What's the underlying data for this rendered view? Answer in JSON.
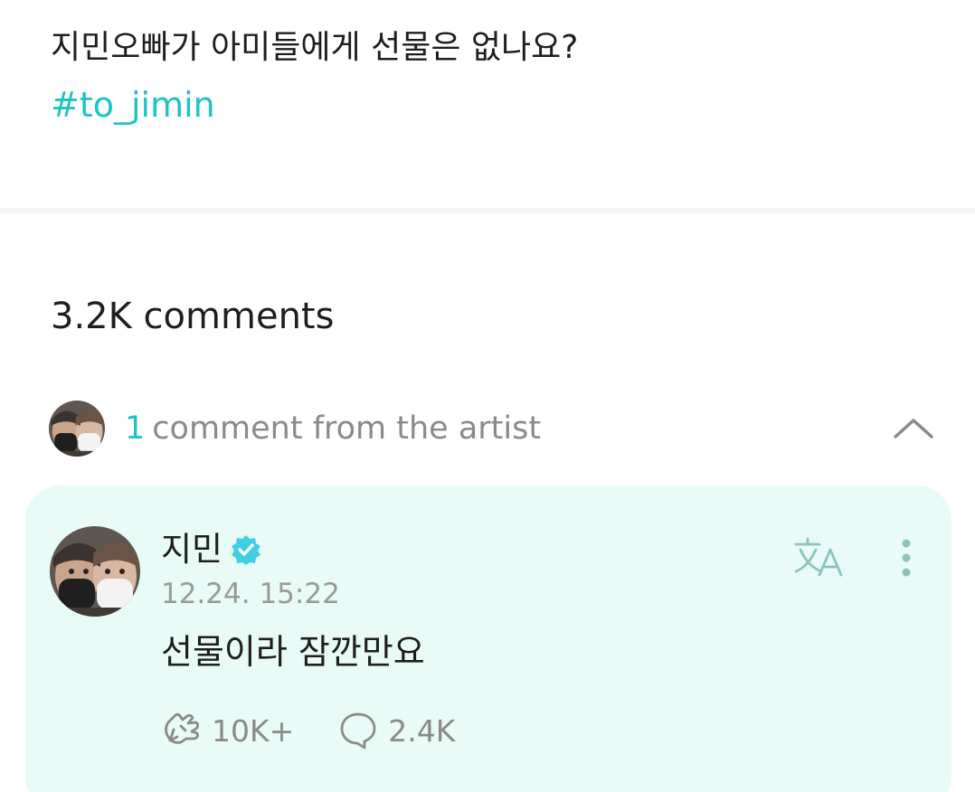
{
  "post": {
    "text": "지민오빠가 아미들에게 선물은 없나요?",
    "hashtag": "#to_jimin"
  },
  "comments": {
    "count_label": "3.2K comments",
    "artist_summary": {
      "count": "1",
      "label": "comment from the artist"
    }
  },
  "artist_comment": {
    "author": "지민",
    "timestamp": "12.24. 15:22",
    "body": "선물이라 잠깐만요",
    "likes": "10K+",
    "replies": "2.4K"
  },
  "icons": {
    "verified": "verified-badge-icon",
    "translate": "translate-icon",
    "more": "more-vertical-icon",
    "like": "like-hands-icon",
    "reply": "reply-bubble-icon",
    "collapse": "chevron-up-icon"
  },
  "colors": {
    "accent": "#1ec3c3",
    "card_background": "#e9fbf6",
    "muted_text": "#8a8a8a",
    "verified_badge": "#3fcfe3"
  }
}
